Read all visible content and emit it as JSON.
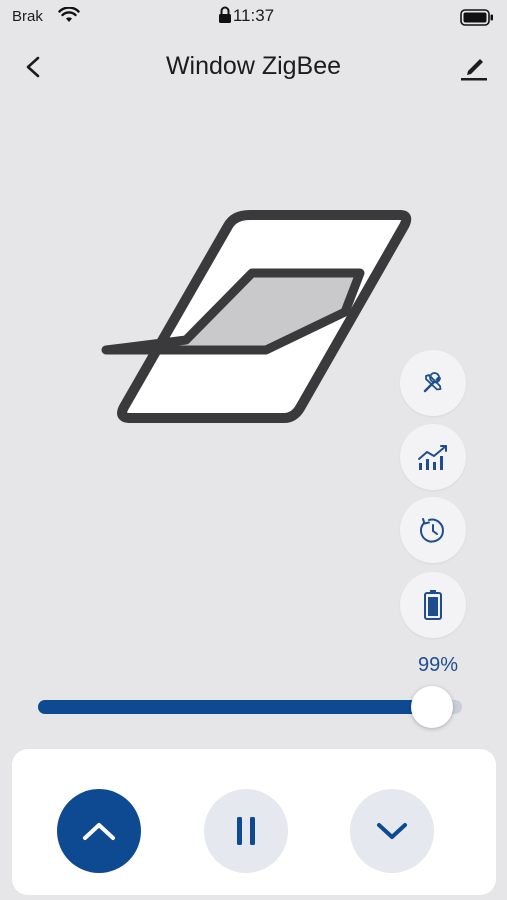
{
  "status_bar": {
    "carrier": "Brak",
    "time": "11:37"
  },
  "header": {
    "title": "Window ZigBee"
  },
  "device": {
    "position_label": "99%",
    "position_fraction": 0.93
  },
  "side_actions": [
    {
      "name": "settings-tools",
      "icon": "tools-icon"
    },
    {
      "name": "statistics",
      "icon": "chart-icon"
    },
    {
      "name": "timer",
      "icon": "clock-icon"
    },
    {
      "name": "battery",
      "icon": "battery-icon"
    }
  ],
  "controls": {
    "open_icon": "chevron-up-icon",
    "stop_icon": "pause-icon",
    "close_icon": "chevron-down-icon"
  },
  "colors": {
    "accent": "#0d4a92",
    "background": "#e6e5e8",
    "percent_text": "#1f4e8c"
  }
}
